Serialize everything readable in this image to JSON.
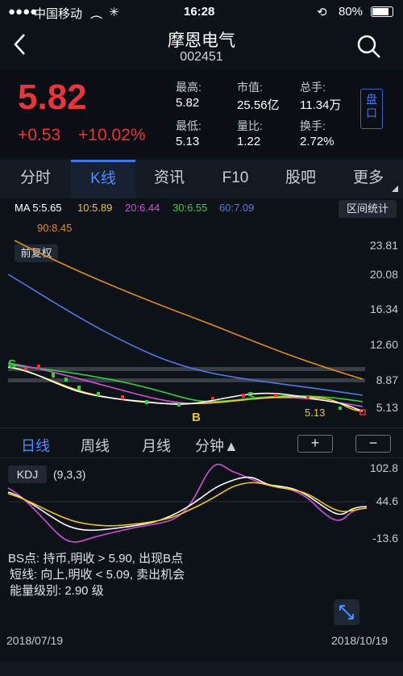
{
  "status_bar": {
    "carrier": "中国移动",
    "time": "16:28",
    "battery": "80%"
  },
  "nav": {
    "title": "摩恩电气",
    "code": "002451"
  },
  "quote": {
    "price": "5.82",
    "change": "+0.53",
    "change_pct": "+10.02%",
    "stats": [
      {
        "label": "最高:",
        "value": "5.82"
      },
      {
        "label": "最低:",
        "value": "5.13"
      },
      {
        "label": "市值:",
        "value": "25.56亿"
      },
      {
        "label": "量比:",
        "value": "1.22"
      },
      {
        "label": "总手:",
        "value": "11.34万"
      },
      {
        "label": "换手:",
        "value": "2.72%"
      }
    ],
    "side_button": "盘口"
  },
  "tabs": [
    "分时",
    "K线",
    "资讯",
    "F10",
    "股吧",
    "更多"
  ],
  "ma": {
    "items": [
      "MA 5:5.65",
      "10:5.89",
      "20:6.44",
      "30:6.55",
      "60:7.09",
      "90:8.45"
    ],
    "colors": [
      "#ffffff",
      "#f5c518",
      "#d04fd8",
      "#34d040",
      "#4e7be8",
      "#e08a1e"
    ],
    "range_button": "区间统计",
    "adjust_button": "前复权"
  },
  "chart_data": {
    "type": "line",
    "price_axis": [
      "23.81",
      "20.08",
      "16.34",
      "12.60",
      "8.87",
      "5.13"
    ],
    "markers": {
      "sell": "S",
      "buy": "B",
      "low": "5.13"
    },
    "x_range": [
      "2018/07/19",
      "2018/10/19"
    ],
    "kdj_axis": [
      "102.8",
      "44.6",
      "-13.6"
    ],
    "kdj_label": "KDJ",
    "kdj_params": "(9,3,3)"
  },
  "period": {
    "items": [
      "日线",
      "周线",
      "月线",
      "分钟▲"
    ],
    "plus": "+",
    "minus": "−"
  },
  "info": [
    "BS点: 持币,明收 > 5.90, 出现B点",
    "短线: 向上,明收 < 5.09, 卖出机会",
    "能量级别: 2.90 级"
  ]
}
